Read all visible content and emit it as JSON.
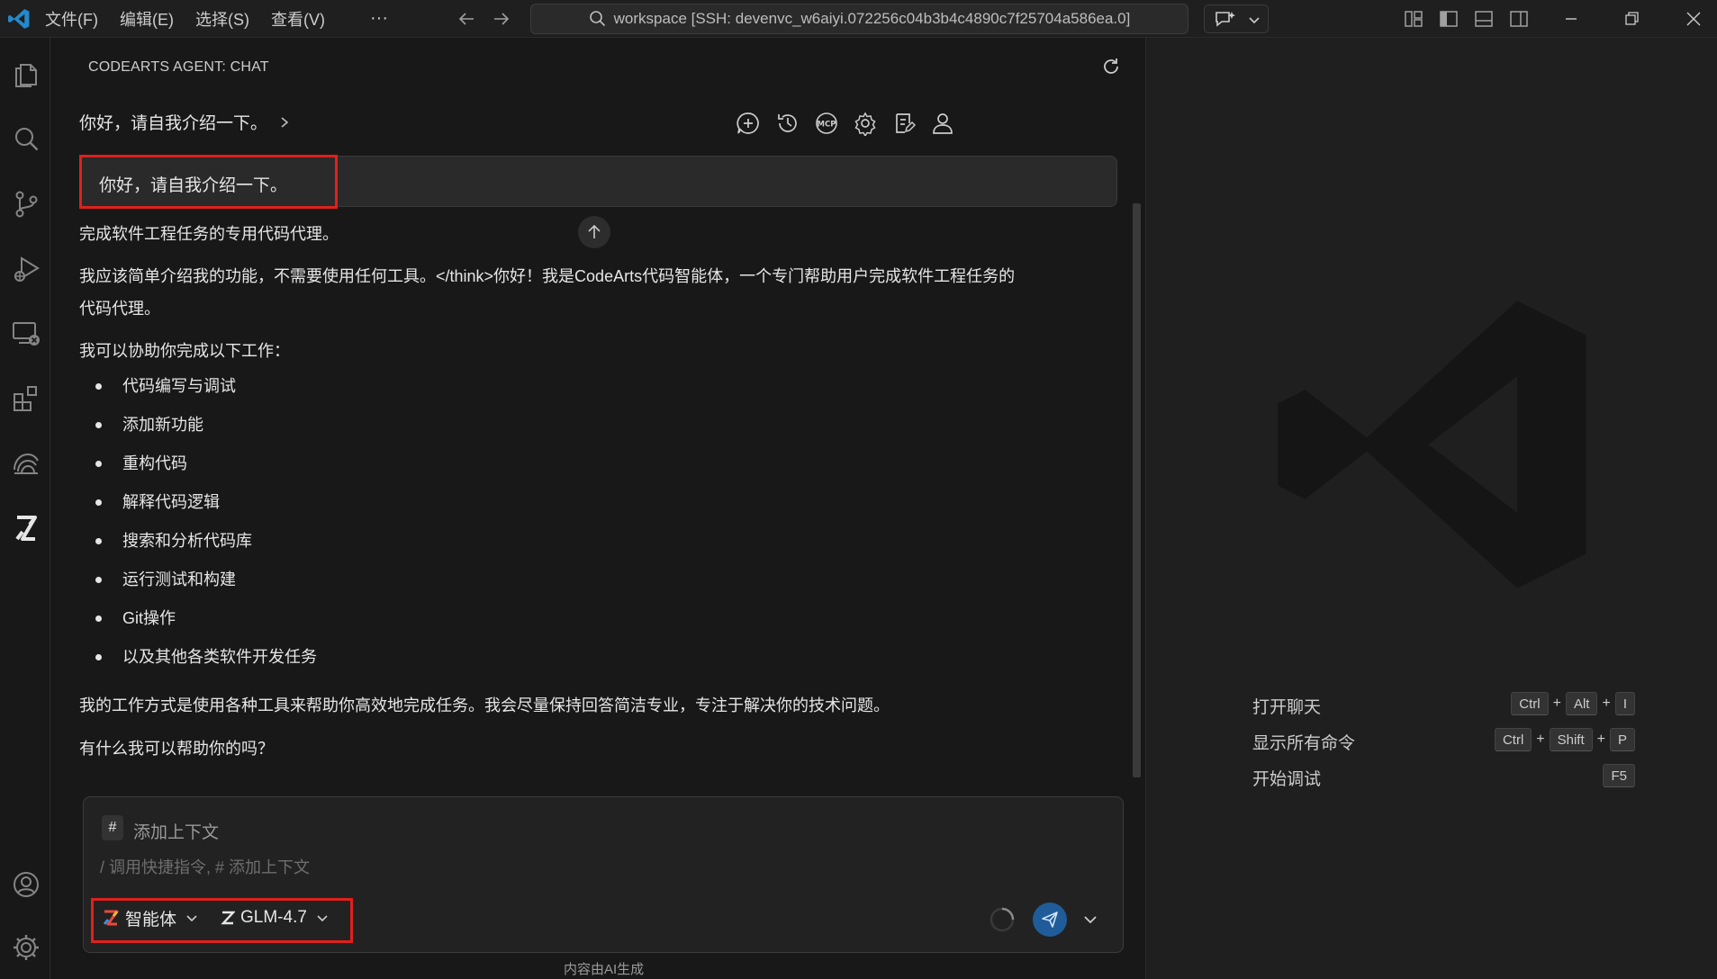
{
  "titlebar": {
    "menu": [
      "文件(F)",
      "编辑(E)",
      "选择(S)",
      "查看(V)"
    ],
    "more_label": "···",
    "search_text": "workspace [SSH: devenvc_w6aiyi.072256c04b3b4c4890c7f25704a586ea.0]"
  },
  "activity_bar": {
    "items": [
      "explorer-icon",
      "search-icon",
      "source-control-icon",
      "run-debug-icon",
      "remote-explorer-icon",
      "extensions-icon",
      "codearts-cloud-icon",
      "codearts-agent-icon",
      "account-icon",
      "settings-gear-icon"
    ]
  },
  "chat": {
    "panel_title": "CODEARTS AGENT: CHAT",
    "breadcrumb": "你好，请自我介绍一下。",
    "user_message": "你好，请自我介绍一下。",
    "response": {
      "p1": "完成软件工程任务的专用代码代理。",
      "p2_line1": "我应该简单介绍我的功能，不需要使用任何工具。</think>你好！我是CodeArts代码智能体，一个专门帮助用户完成软件工程任务的",
      "p2_line2": "代码代理。",
      "p3": "我可以协助你完成以下工作：",
      "list": [
        "代码编写与调试",
        "添加新功能",
        "重构代码",
        "解释代码逻辑",
        "搜索和分析代码库",
        "运行测试和构建",
        "Git操作",
        "以及其他各类软件开发任务"
      ],
      "p4": "我的工作方式是使用各种工具来帮助你高效地完成任务。我会尽量保持回答简洁专业，专注于解决你的技术问题。",
      "p5": "有什么我可以帮助你的吗？"
    },
    "input": {
      "context_hash": "#",
      "context_label": "添加上下文",
      "placeholder": "/ 调用快捷指令, # 添加上下文",
      "agent_label": "智能体",
      "model_label": "GLM-4.7"
    },
    "footer_note": "内容由AI生成"
  },
  "editor": {
    "shortcuts": [
      {
        "name": "打开聊天",
        "keys": [
          "Ctrl",
          "Alt",
          "I"
        ]
      },
      {
        "name": "显示所有命令",
        "keys": [
          "Ctrl",
          "Shift",
          "P"
        ]
      },
      {
        "name": "开始调试",
        "keys": [
          "F5"
        ]
      }
    ]
  },
  "colors": {
    "accent_blue": "#1f5c99",
    "vscode_blue": "#2489ca",
    "highlight_red": "#e0201c"
  }
}
